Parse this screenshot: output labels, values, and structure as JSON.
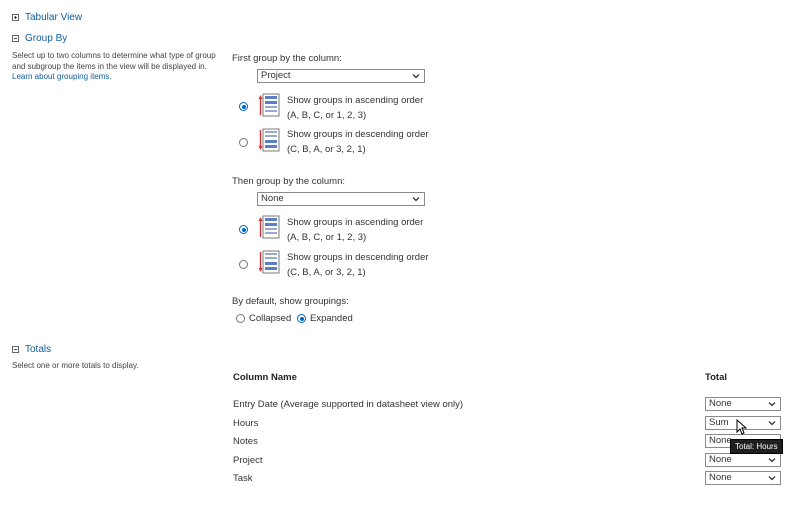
{
  "sections": {
    "tabular_view": {
      "label": "Tabular View"
    },
    "group_by": {
      "label": "Group By",
      "description": "Select up to two columns to determine what type of group and subgroup the items in the view will be displayed in.",
      "learn_more": "Learn about grouping items.",
      "first": {
        "label": "First group by the column:",
        "selected": "Project",
        "ascending_line1": "Show groups in ascending order",
        "ascending_line2": "(A, B, C, or 1, 2, 3)",
        "descending_line1": "Show groups in descending order",
        "descending_line2": "(C, B, A, or 3, 2, 1)",
        "order": "ascending"
      },
      "then": {
        "label": "Then group by the column:",
        "selected": "None",
        "ascending_line1": "Show groups in ascending order",
        "ascending_line2": "(A, B, C, or 1, 2, 3)",
        "descending_line1": "Show groups in descending order",
        "descending_line2": "(C, B, A, or 3, 2, 1)",
        "order": "ascending"
      },
      "default_show": {
        "label": "By default, show groupings:",
        "collapsed_label": "Collapsed",
        "expanded_label": "Expanded",
        "selected": "expanded"
      }
    },
    "totals": {
      "label": "Totals",
      "description": "Select one or more totals to display.",
      "column_header": "Column Name",
      "total_header": "Total",
      "rows": [
        {
          "name": "Entry Date   (Average supported in datasheet view only)",
          "total": "None"
        },
        {
          "name": "Hours",
          "total": "Sum"
        },
        {
          "name": "Notes",
          "total": "None"
        },
        {
          "name": "Project",
          "total": "None"
        },
        {
          "name": "Task",
          "total": "None"
        }
      ],
      "tooltip": "Total: Hours"
    }
  },
  "colors": {
    "link": "#0f5c9e",
    "radio_selected": "#0067c0",
    "icon_blue": "#5b7fc7",
    "icon_red": "#d13438"
  },
  "icons": {
    "sort_ascending": "sort-ascending-icon",
    "sort_descending": "sort-descending-icon",
    "dropdown": "chevron-down-icon"
  }
}
